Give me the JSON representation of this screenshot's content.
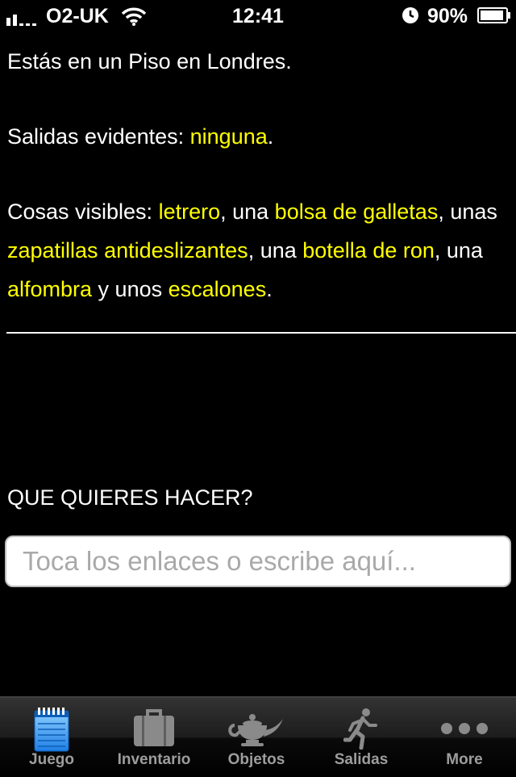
{
  "status_bar": {
    "carrier": "O2-UK",
    "time": "12:41",
    "battery_percent": "90%"
  },
  "game": {
    "location_line": "Estás en un Piso en Londres.",
    "exits": {
      "prefix": "Salidas evidentes: ",
      "link": "ninguna",
      "suffix": "."
    },
    "things": {
      "prefix": "Cosas visibles: ",
      "segments": [
        {
          "text": "letrero",
          "link": true
        },
        {
          "text": ", una ",
          "link": false
        },
        {
          "text": "bolsa de galletas",
          "link": true
        },
        {
          "text": ", unas ",
          "link": false
        },
        {
          "text": "zapatillas antideslizantes",
          "link": true
        },
        {
          "text": ", una ",
          "link": false
        },
        {
          "text": "botella de ron",
          "link": true
        },
        {
          "text": ", una ",
          "link": false
        },
        {
          "text": "alfombra",
          "link": true
        },
        {
          "text": " y unos ",
          "link": false
        },
        {
          "text": "escalones",
          "link": true
        },
        {
          "text": ".",
          "link": false
        }
      ]
    },
    "prompt": "QUE QUIERES HACER?",
    "input": {
      "value": "",
      "placeholder": "Toca los enlaces o escribe aquí..."
    }
  },
  "tab_bar": {
    "tabs": [
      {
        "label": "Juego",
        "icon": "notepad-icon",
        "active": true
      },
      {
        "label": "Inventario",
        "icon": "suitcase-icon",
        "active": false
      },
      {
        "label": "Objetos",
        "icon": "magic-lamp-icon",
        "active": false
      },
      {
        "label": "Salidas",
        "icon": "running-man-icon",
        "active": false
      },
      {
        "label": "More",
        "icon": "more-dots-icon",
        "active": false
      }
    ]
  },
  "colors": {
    "background": "#000000",
    "text": "#ffffff",
    "link": "#ffff00"
  }
}
